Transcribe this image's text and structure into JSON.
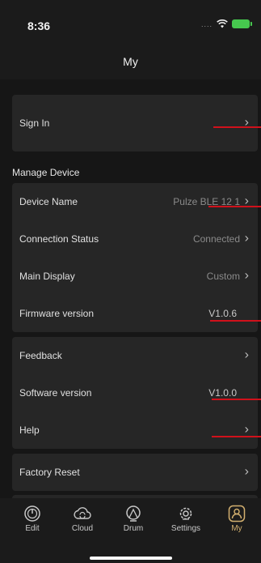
{
  "status": {
    "time": "8:36",
    "signal": "....",
    "wifi_icon": "wifi-icon",
    "battery_icon": "battery-charging-icon"
  },
  "header": {
    "title": "My"
  },
  "account": {
    "sign_in": "Sign In"
  },
  "manage": {
    "section_title": "Manage Device",
    "device_name_label": "Device Name",
    "device_name_value": "Pulze BLE 12 1",
    "connection_label": "Connection Status",
    "connection_value": "Connected",
    "main_display_label": "Main Display",
    "main_display_value": "Custom",
    "firmware_label": "Firmware version",
    "firmware_value": "V1.0.6"
  },
  "support": {
    "feedback_label": "Feedback",
    "software_label": "Software version",
    "software_value": "V1.0.0",
    "help_label": "Help"
  },
  "reset": {
    "factory_reset_label": "Factory Reset"
  },
  "tabs": [
    {
      "label": "Edit",
      "icon": "gauge-icon"
    },
    {
      "label": "Cloud",
      "icon": "cloud-sync-icon"
    },
    {
      "label": "Drum",
      "icon": "drum-icon"
    },
    {
      "label": "Settings",
      "icon": "gear-icon"
    },
    {
      "label": "My",
      "icon": "user-icon"
    }
  ],
  "colors": {
    "background": "#161616",
    "card": "#262626",
    "accent": "#d3b06f",
    "annotation": "#d0111b"
  }
}
